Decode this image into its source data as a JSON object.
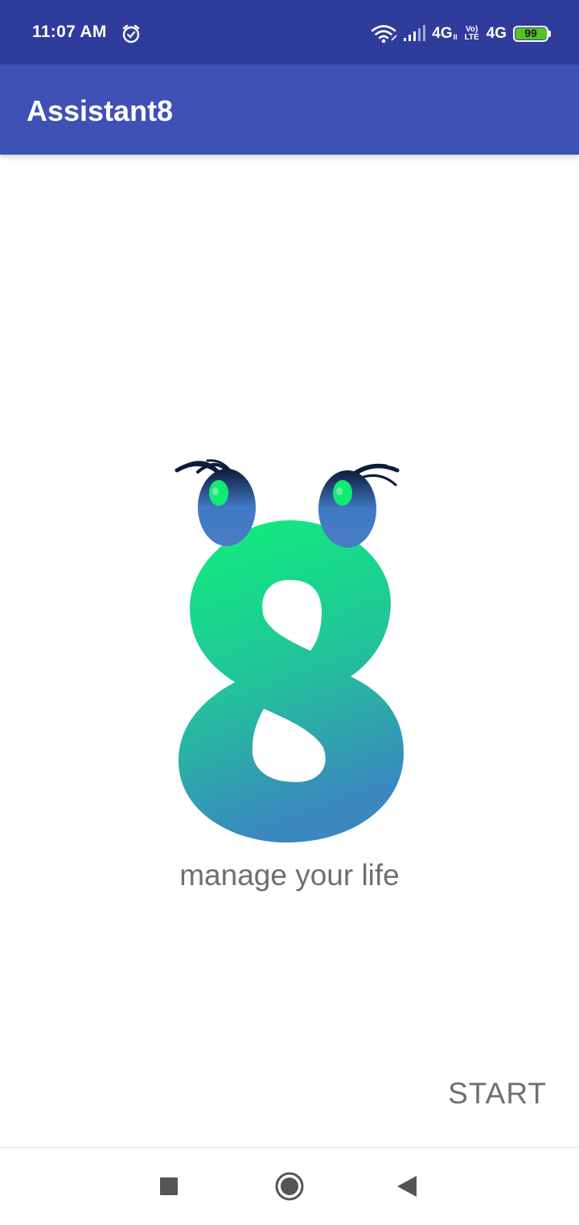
{
  "status_bar": {
    "time": "11:07 AM",
    "alarm_icon": "alarm-icon",
    "wifi_icon": "wifi-icon",
    "signal_icon": "signal-icon",
    "network_1": "4G",
    "network_1_suffix": "II",
    "volte_top": "Vo)",
    "volte_bottom": "LTE",
    "network_2": "4G",
    "battery_level": "99",
    "battery_color": "#57c22a"
  },
  "app_bar": {
    "title": "Assistant8",
    "color": "#3f51b5"
  },
  "main": {
    "logo_icon": "assistant8-logo-icon",
    "tagline": "manage your life",
    "start_label": "START"
  },
  "nav_bar": {
    "recents_icon": "square-icon",
    "home_icon": "circle-icon",
    "back_icon": "triangle-back-icon"
  }
}
